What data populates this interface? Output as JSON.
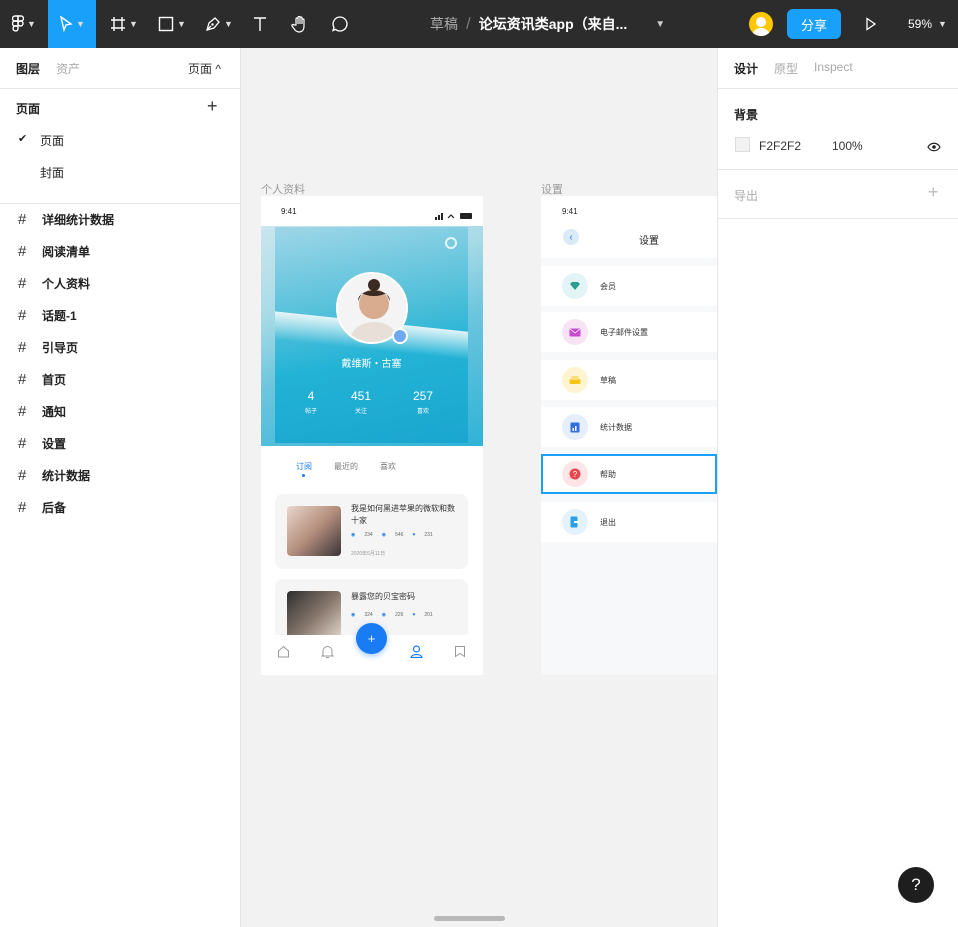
{
  "toolbar": {
    "breadcrumb_drafts": "草稿",
    "breadcrumb_sep": "/",
    "file_name": "论坛资讯类app（来自...",
    "share_label": "分享",
    "zoom_label": "59%",
    "icons": [
      "figma-menu-icon",
      "move-icon",
      "frame-icon",
      "shape-icon",
      "pen-icon",
      "text-icon",
      "hand-icon",
      "comment-icon",
      "chevron-down-icon",
      "play-icon"
    ]
  },
  "left_panel": {
    "tab_layers": "图层",
    "tab_assets": "资产",
    "pages_toggle": "页面 ^",
    "pages_title": "页面",
    "pages": [
      {
        "label": "页面",
        "checked": true
      },
      {
        "label": "封面",
        "checked": false
      }
    ],
    "frames": [
      "详细统计数据",
      "阅读清单",
      "个人资料",
      "话题-1",
      "引导页",
      "首页",
      "通知",
      "设置",
      "统计数据",
      "后备"
    ]
  },
  "canvas": {
    "frame_profile_label": "个人资料",
    "frame_settings_label": "设置",
    "profile": {
      "time": "9:41",
      "user_name": "戴维斯・古塞",
      "stats": [
        {
          "value": "4",
          "label": "帖子"
        },
        {
          "value": "451",
          "label": "关注"
        },
        {
          "value": "257",
          "label": "喜欢"
        }
      ],
      "tabs": [
        "订阅",
        "最近的",
        "喜欢"
      ],
      "active_tab": "订阅",
      "articles": [
        {
          "title": "我是如何黑进苹果的微软和数十家",
          "views": "234",
          "comments": "546",
          "likes": "231",
          "date": "2020年6月11日"
        },
        {
          "title": "暴露您的贝宝密码",
          "views": "324",
          "comments": "226",
          "likes": "201"
        }
      ],
      "fab_label": "+"
    },
    "settings": {
      "time": "9:41",
      "title": "设置",
      "items": [
        {
          "label": "会员",
          "color": "#e3f4f6"
        },
        {
          "label": "电子邮件设置",
          "color": "#f7e3f3"
        },
        {
          "label": "草稿",
          "color": "#fff4d1"
        },
        {
          "label": "统计数据",
          "color": "#e6eefa"
        },
        {
          "label": "帮助",
          "color": "#fde4e6"
        },
        {
          "label": "退出",
          "color": "#e3f2fb"
        }
      ],
      "selected": "帮助"
    }
  },
  "right_panel": {
    "tab_design": "设计",
    "tab_prototype": "原型",
    "tab_inspect": "Inspect",
    "background_title": "背景",
    "bg_hex": "F2F2F2",
    "bg_opacity": "100%",
    "export_title": "导出"
  },
  "help_label": "?",
  "colors": {
    "accent": "#18a0fb",
    "toolbar": "#2c2c2c",
    "fab": "#1a7cf5"
  }
}
